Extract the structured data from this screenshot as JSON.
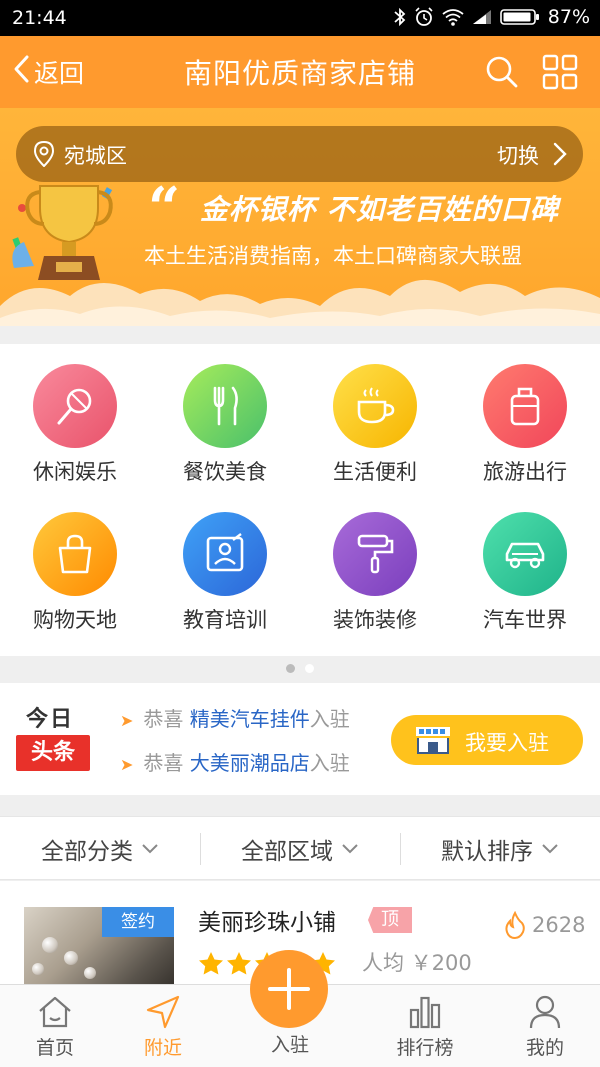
{
  "status_bar": {
    "time": "21:44",
    "battery": "87%"
  },
  "nav": {
    "back_label": "返回",
    "title": "南阳优质商家店铺"
  },
  "banner": {
    "district": "宛城区",
    "switch_label": "切换",
    "slogan": "金杯银杯 不如老百姓的口碑",
    "subslogan": "本土生活消费指南，本土口碑商家大联盟"
  },
  "categories": [
    {
      "label": "休闲娱乐",
      "icon": "microphone-icon"
    },
    {
      "label": "餐饮美食",
      "icon": "fork-knife-icon"
    },
    {
      "label": "生活便利",
      "icon": "coffee-cup-icon"
    },
    {
      "label": "旅游出行",
      "icon": "suitcase-icon"
    },
    {
      "label": "购物天地",
      "icon": "shopping-bag-icon"
    },
    {
      "label": "教育培训",
      "icon": "education-board-icon"
    },
    {
      "label": "装饰装修",
      "icon": "paint-roller-icon"
    },
    {
      "label": "汽车世界",
      "icon": "car-icon"
    }
  ],
  "headline": {
    "today": "今日",
    "tag": "头条",
    "items": [
      {
        "prefix": "恭喜 ",
        "name": "精美汽车挂件",
        "suffix": "入驻"
      },
      {
        "prefix": "恭喜 ",
        "name": "大美丽潮品店",
        "suffix": "入驻"
      }
    ],
    "join_label": "我要入驻"
  },
  "filters": [
    "全部分类",
    "全部区域",
    "默认排序"
  ],
  "stores": [
    {
      "badge": "签约",
      "name": "美丽珍珠小铺",
      "tag": "顶",
      "rating": 5,
      "price": "人均 ￥200",
      "heat": "2628"
    }
  ],
  "tabbar": {
    "items": [
      {
        "label": "首页",
        "icon": "home-icon"
      },
      {
        "label": "附近",
        "icon": "navigation-arrow-icon"
      },
      {
        "label": "入驻",
        "icon": "plus-icon"
      },
      {
        "label": "排行榜",
        "icon": "bar-chart-icon"
      },
      {
        "label": "我的",
        "icon": "user-icon"
      }
    ],
    "active_index": 1
  },
  "colors": {
    "accent": "#ff9a2e",
    "link": "#2966c6",
    "hot_tag": "#e8312a",
    "join_button": "#ffc21c"
  }
}
